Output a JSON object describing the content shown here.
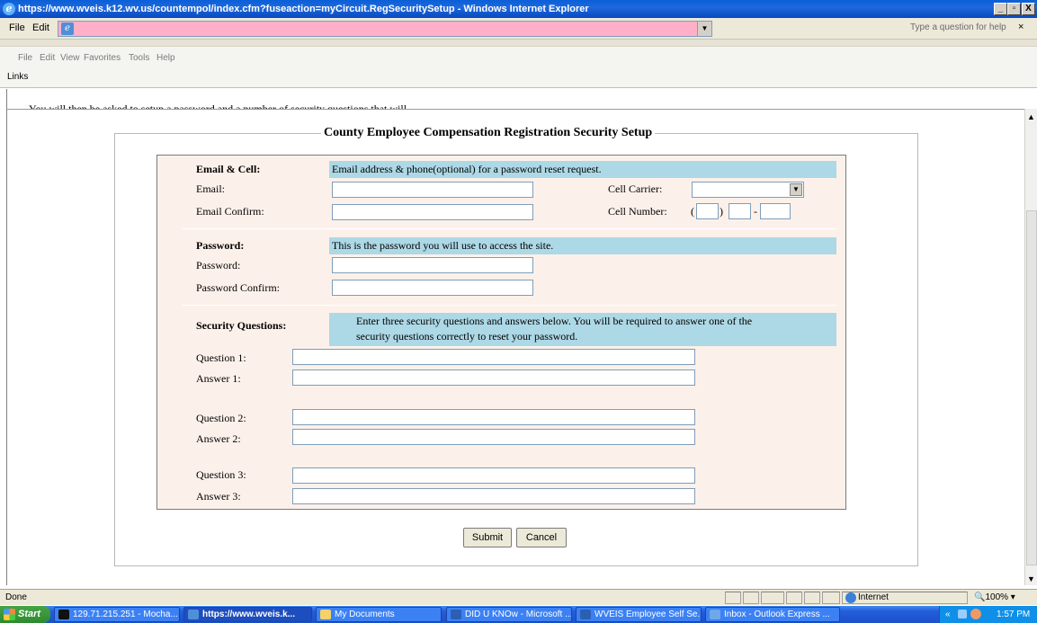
{
  "window": {
    "title": "https://www.wveis.k12.wv.us/countempol/index.cfm?fuseaction=myCircuit.RegSecuritySetup - Windows Internet Explorer",
    "min": "_",
    "max": "▫",
    "close": "X"
  },
  "word_menu": {
    "file": "File",
    "edit": "Edit",
    "help_placeholder": "Type a question for help",
    "help_close": "×"
  },
  "ie_menu": {
    "items": [
      "File",
      "Edit",
      "View",
      "Favorites",
      "Tools",
      "Help"
    ],
    "links": "Links"
  },
  "page": {
    "cutoff_text": "You will then be asked to setup a password and a number of security questions that will",
    "legend": "County Employee Compensation Registration Security Setup",
    "email_section": {
      "heading": "Email & Cell:",
      "note": "Email address & phone(optional) for a password reset request.",
      "email_label": "Email:",
      "email_confirm_label": "Email Confirm:",
      "carrier_label": "Cell Carrier:",
      "number_label": "Cell Number:",
      "paren_open": "(",
      "paren_close": ")",
      "dash": "-"
    },
    "password_section": {
      "heading": "Password:",
      "note": "This is the password you will use to access the site.",
      "password_label": "Password:",
      "password_confirm_label": "Password Confirm:"
    },
    "security_section": {
      "heading": "Security Questions:",
      "note_line1": "Enter three security questions and answers below. You will be required to answer one of the",
      "note_line2": "security questions correctly to reset your password.",
      "q1": "Question 1:",
      "a1": "Answer 1:",
      "q2": "Question 2:",
      "a2": "Answer 2:",
      "q3": "Question 3:",
      "a3": "Answer 3:"
    },
    "submit": "Submit",
    "cancel": "Cancel"
  },
  "status": {
    "text": "Done",
    "zone": "Internet",
    "zoom": "100%"
  },
  "taskbar": {
    "start": "Start",
    "tasks": [
      "129.71.215.251 - Mocha...",
      "https://www.wveis.k...",
      "My Documents",
      "DID U KNOw - Microsoft ...",
      "WVEIS Employee Self Se...",
      "Inbox - Outlook Express ..."
    ],
    "tray_chevron": "«",
    "time": "1:57 PM"
  }
}
